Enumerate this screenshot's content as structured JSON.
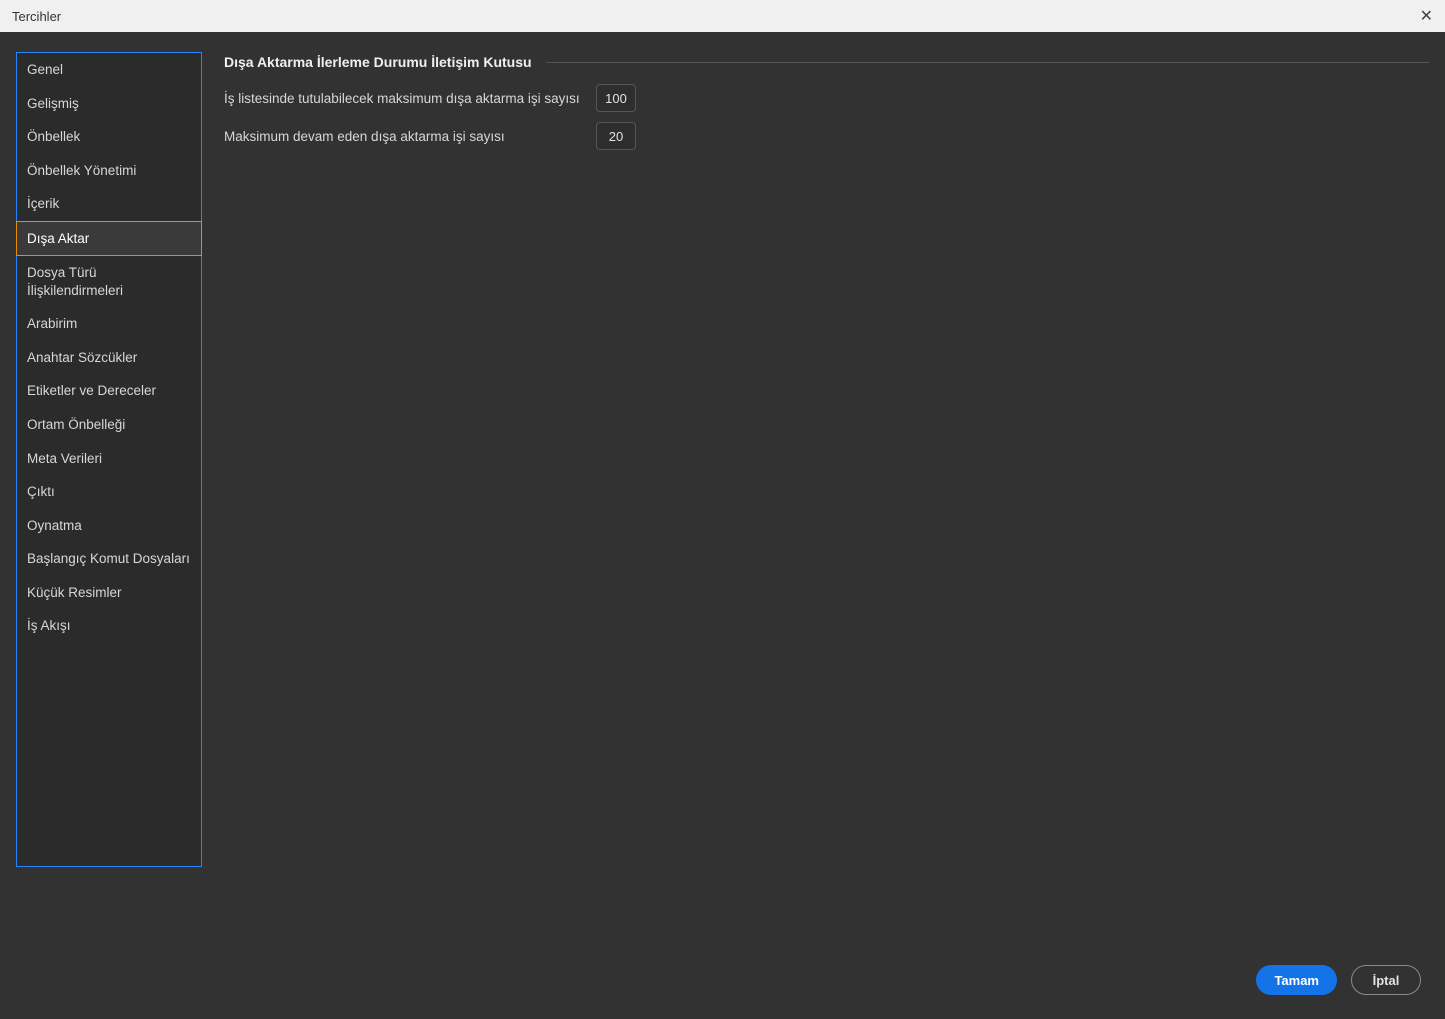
{
  "window": {
    "title": "Tercihler",
    "close_glyph": "✕"
  },
  "sidebar": {
    "items": [
      {
        "id": "general",
        "label": "Genel"
      },
      {
        "id": "advanced",
        "label": "Gelişmiş"
      },
      {
        "id": "cache",
        "label": "Önbellek"
      },
      {
        "id": "cache-management",
        "label": "Önbellek Yönetimi"
      },
      {
        "id": "content",
        "label": "İçerik"
      },
      {
        "id": "export",
        "label": "Dışa Aktar"
      },
      {
        "id": "file-type-associations",
        "label": "Dosya Türü İlişkilendirmeleri"
      },
      {
        "id": "interface",
        "label": "Arabirim"
      },
      {
        "id": "keywords",
        "label": "Anahtar Sözcükler"
      },
      {
        "id": "labels-ratings",
        "label": "Etiketler ve Dereceler"
      },
      {
        "id": "media-cache",
        "label": "Ortam Önbelleği"
      },
      {
        "id": "metadata",
        "label": "Meta Verileri"
      },
      {
        "id": "output",
        "label": "Çıktı"
      },
      {
        "id": "playback",
        "label": "Oynatma"
      },
      {
        "id": "startup-scripts",
        "label": "Başlangıç Komut Dosyaları"
      },
      {
        "id": "thumbnails",
        "label": "Küçük Resimler"
      },
      {
        "id": "workflow",
        "label": "İş Akışı"
      }
    ],
    "selected_id": "export"
  },
  "content": {
    "section_title": "Dışa Aktarma İlerleme Durumu İletişim Kutusu",
    "fields": {
      "max_jobs_label": "İş listesinde tutulabilecek maksimum dışa aktarma işi sayısı",
      "max_jobs_value": "100",
      "max_concurrent_label": "Maksimum devam eden dışa aktarma işi sayısı",
      "max_concurrent_value": "20"
    }
  },
  "buttons": {
    "ok": "Tamam",
    "cancel": "İptal"
  }
}
